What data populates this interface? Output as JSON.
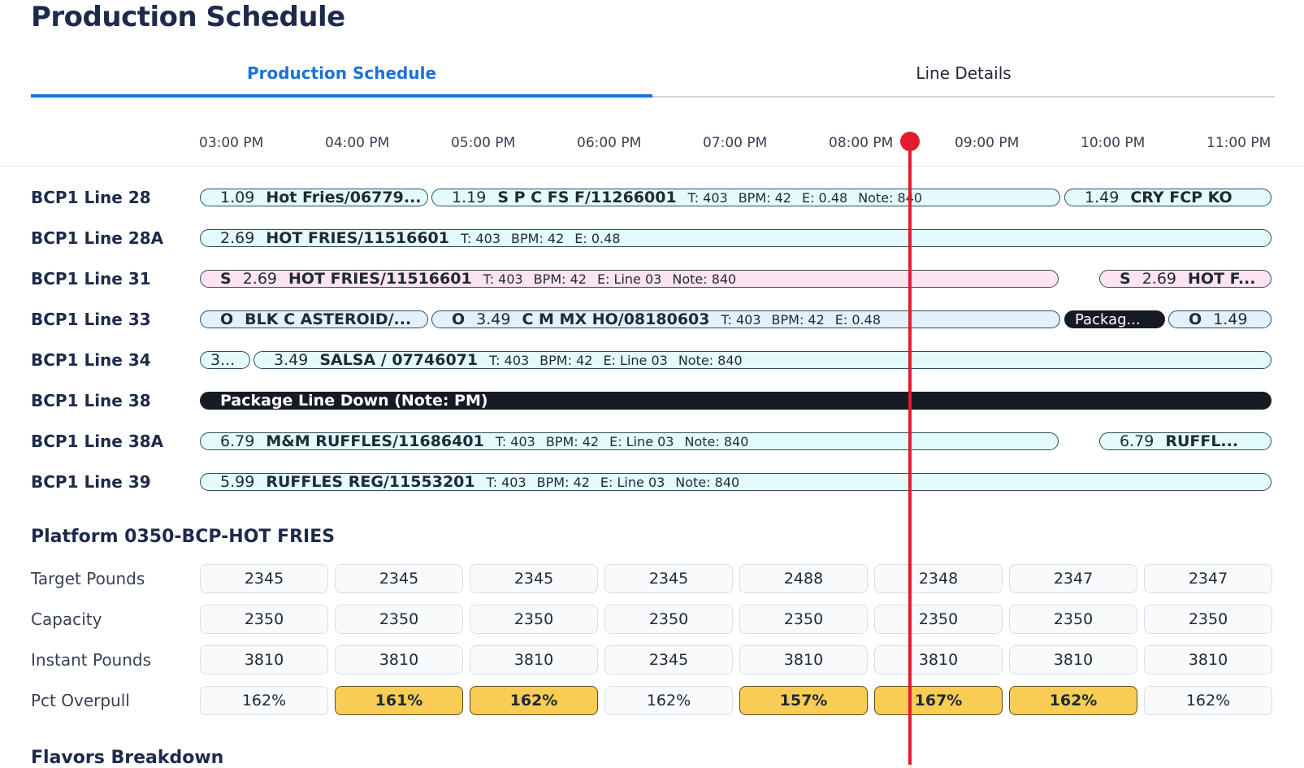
{
  "header": {
    "title": "Production Schedule"
  },
  "tabs": [
    {
      "label": "Production Schedule",
      "active": true
    },
    {
      "label": "Line Details",
      "active": false
    }
  ],
  "timeline": {
    "hours": [
      "03:00 PM",
      "04:00 PM",
      "05:00 PM",
      "06:00 PM",
      "07:00 PM",
      "08:00 PM",
      "09:00 PM",
      "10:00 PM",
      "11:00 PM"
    ]
  },
  "lines": [
    {
      "label": "BCP1 Line 28",
      "bars": [
        {
          "val": "1.09",
          "name": "Hot Fries/06779...",
          "style": "cyan"
        },
        {
          "val": "1.19",
          "name": "S P C FS F/11266001",
          "details": [
            "T: 403",
            "BPM: 42",
            "E: 0.48",
            "Note: 840"
          ],
          "style": "cyan"
        },
        {
          "val": "1.49",
          "name": "CRY FCP KO",
          "style": "cyan"
        }
      ]
    },
    {
      "label": "BCP1 Line 28A",
      "bars": [
        {
          "val": "2.69",
          "name": "HOT FRIES/11516601",
          "details": [
            "T: 403",
            "BPM: 42",
            "E: 0.48"
          ],
          "style": "cyan"
        }
      ]
    },
    {
      "label": "BCP1 Line 31",
      "bars": [
        {
          "flag": "S",
          "val": "2.69",
          "name": "HOT FRIES/11516601",
          "details": [
            "T: 403",
            "BPM: 42",
            "E: Line 03",
            "Note: 840"
          ],
          "style": "pink"
        },
        {
          "flag": "S",
          "val": "2.69",
          "name": "HOT F...",
          "style": "pink"
        }
      ]
    },
    {
      "label": "BCP1 Line 33",
      "bars": [
        {
          "flag": "O",
          "name": "BLK C ASTEROID/...",
          "style": "blue"
        },
        {
          "flag": "O",
          "val": "3.49",
          "name": "C M MX HO/08180603",
          "details": [
            "T: 403",
            "BPM: 42",
            "E: 0.48"
          ],
          "style": "blue"
        },
        {
          "text": "Packag...",
          "style": "dark"
        },
        {
          "flag": "O",
          "val": "1.49",
          "style": "blue"
        }
      ]
    },
    {
      "label": "BCP1 Line 34",
      "bars": [
        {
          "text": "3...",
          "style": "cyan"
        },
        {
          "val": "3.49",
          "name": "SALSA / 07746071",
          "details": [
            "T: 403",
            "BPM: 42",
            "E: Line 03",
            "Note: 840"
          ],
          "style": "cyan"
        }
      ]
    },
    {
      "label": "BCP1 Line 38",
      "bars": [
        {
          "name": "Package Line Down (Note: PM)",
          "style": "dark"
        }
      ]
    },
    {
      "label": "BCP1 Line 38A",
      "bars": [
        {
          "val": "6.79",
          "name": "M&M RUFFLES/11686401",
          "details": [
            "T: 403",
            "BPM: 42",
            "E: Line 03",
            "Note: 840"
          ],
          "style": "cyan"
        },
        {
          "val": "6.79",
          "name": "RUFFL...",
          "style": "cyan"
        }
      ]
    },
    {
      "label": "BCP1 Line 39",
      "bars": [
        {
          "val": "5.99",
          "name": "RUFFLES REG/11553201",
          "details": [
            "T: 403",
            "BPM: 42",
            "E: Line 03",
            "Note: 840"
          ],
          "style": "cyan"
        }
      ]
    }
  ],
  "platform": {
    "title": "Platform 0350-BCP-HOT FRIES",
    "metrics": [
      {
        "label": "Target Pounds",
        "values": [
          "2345",
          "2345",
          "2345",
          "2345",
          "2488",
          "2348",
          "2347",
          "2347"
        ],
        "highlight": []
      },
      {
        "label": "Capacity",
        "values": [
          "2350",
          "2350",
          "2350",
          "2350",
          "2350",
          "2350",
          "2350",
          "2350"
        ],
        "highlight": []
      },
      {
        "label": "Instant Pounds",
        "values": [
          "3810",
          "3810",
          "3810",
          "2345",
          "3810",
          "3810",
          "3810",
          "3810"
        ],
        "highlight": []
      },
      {
        "label": "Pct Overpull",
        "values": [
          "162%",
          "161%",
          "162%",
          "162%",
          "157%",
          "167%",
          "162%",
          "162%"
        ],
        "highlight": [
          1,
          2,
          4,
          5,
          6
        ]
      }
    ]
  },
  "flavors": {
    "title": "Flavors Breakdown"
  },
  "colors": {
    "accent": "#1a73d9",
    "now_line": "#e11d2e",
    "highlight": "#f7cd53",
    "dark_bar": "#161a24"
  }
}
